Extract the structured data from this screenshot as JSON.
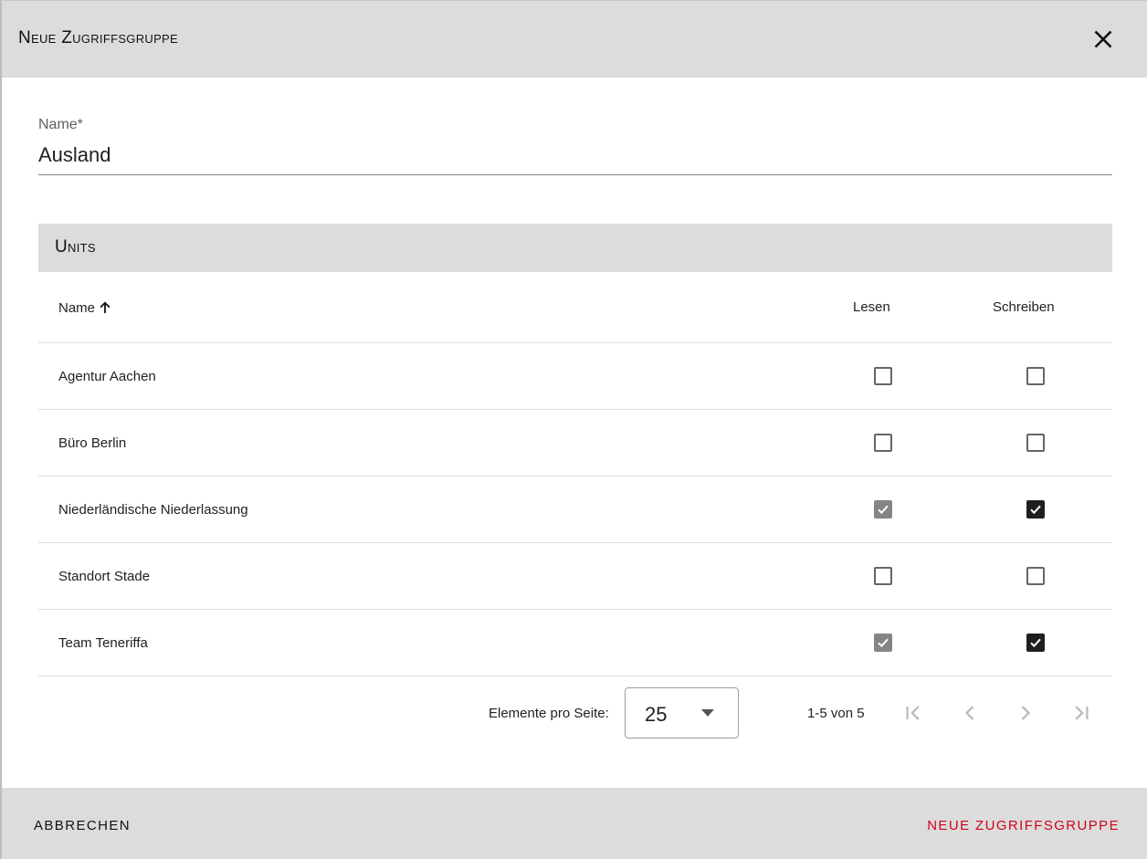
{
  "dialog": {
    "title": "Neue Zugriffsgruppe",
    "close_icon": "close-icon"
  },
  "name_field": {
    "label": "Name*",
    "value": "Ausland"
  },
  "units_section": {
    "title": "Units"
  },
  "table": {
    "columns": {
      "name": "Name",
      "lesen": "Lesen",
      "schreiben": "Schreiben"
    },
    "sort_icon": "arrow-up-icon",
    "rows": [
      {
        "name": "Agentur Aachen",
        "lesen": false,
        "schreiben": false
      },
      {
        "name": "Büro Berlin",
        "lesen": false,
        "schreiben": false
      },
      {
        "name": "Niederländische Niederlassung",
        "lesen": true,
        "schreiben": true
      },
      {
        "name": "Standort Stade",
        "lesen": false,
        "schreiben": false
      },
      {
        "name": "Team Teneriffa",
        "lesen": true,
        "schreiben": true
      }
    ]
  },
  "paginator": {
    "items_per_page_label": "Elemente pro Seite:",
    "page_size": "25",
    "range_label": "1-5 von 5",
    "icons": [
      "first-page-icon",
      "chevron-left-icon",
      "chevron-right-icon",
      "last-page-icon"
    ]
  },
  "footer": {
    "cancel_label": "ABBRECHEN",
    "submit_label": "NEUE ZUGRIFFSGRUPPE"
  },
  "colors": {
    "header_bg": "#dcdcdc",
    "accent": "#d0021b",
    "checkbox_checked": "#1f1f1f",
    "checkbox_disabled_checked": "#858585"
  }
}
